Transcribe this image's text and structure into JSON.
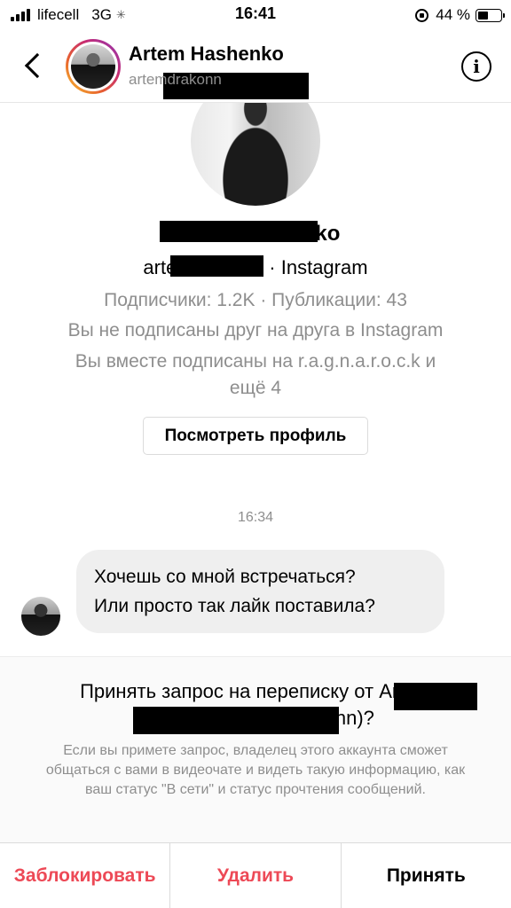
{
  "status_bar": {
    "carrier": "lifecell",
    "network": "3G",
    "time": "16:41",
    "battery_percent": "44 %",
    "battery_level": 0.44
  },
  "header": {
    "name": "Artem Hashenko",
    "username": "artemdrakonn"
  },
  "profile": {
    "name": "Artem Hashenko",
    "handle": "artemdrakonn",
    "source": "· Instagram",
    "stats": "Подписчики: 1.2K · Публикации: 43",
    "follow_status": "Вы не подписаны друг на друга в Instagram",
    "mutual_line1": "Вы вместе подписаны на r.a.g.n.a.r.o.c.k и",
    "mutual_line2": "ещё 4",
    "view_profile_label": "Посмотреть профиль"
  },
  "chat": {
    "timestamp": "16:34",
    "messages": [
      {
        "line1": "Хочешь со мной встречаться?",
        "line2": "Или просто так лайк поставила?"
      }
    ]
  },
  "request": {
    "title_line1": "Принять запрос на переписку от Artem",
    "title_line2": "Hashenko (artemdrakonn)?",
    "description": "Если вы примете запрос, владелец этого аккаунта сможет общаться с вами в видеочате и видеть такую информацию, как ваш статус \"В сети\" и статус прочтения сообщений."
  },
  "actions": {
    "block_label": "Заблокировать",
    "delete_label": "Удалить",
    "accept_label": "Принять"
  },
  "colors": {
    "danger": "#ed4956",
    "secondary_text": "#8e8e8e",
    "bubble": "#efefef"
  }
}
